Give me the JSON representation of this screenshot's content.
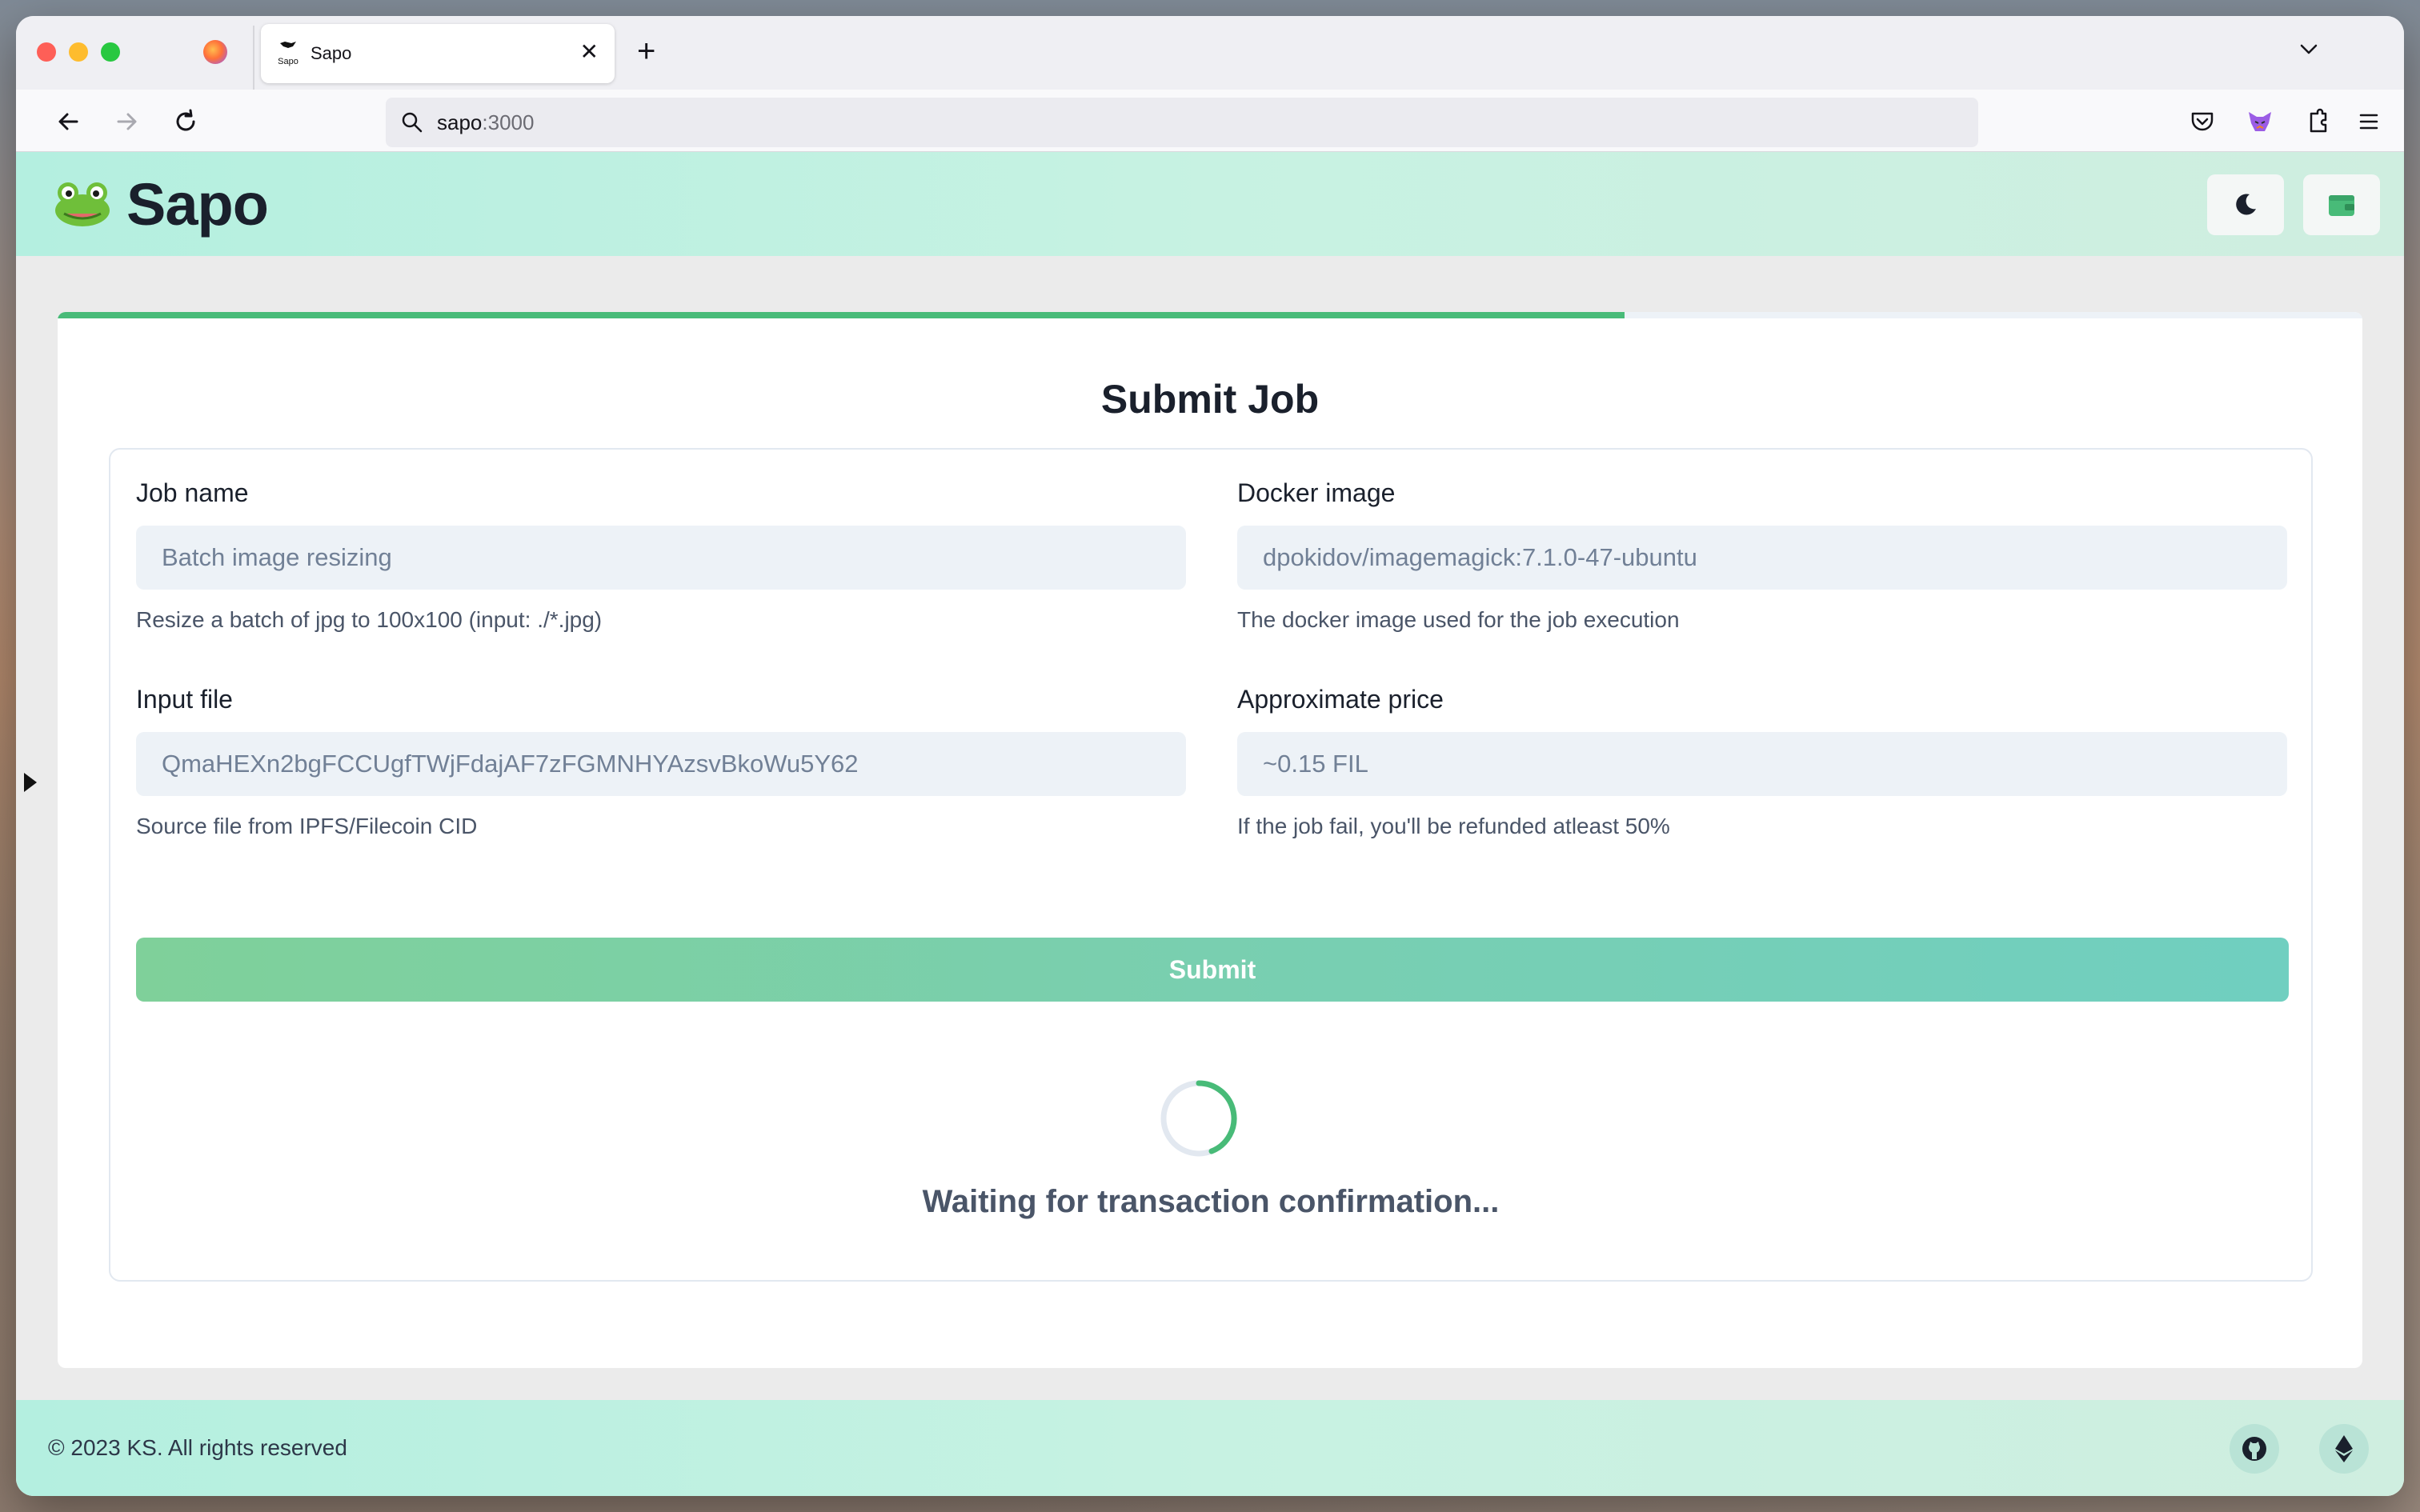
{
  "browser": {
    "tab_title": "Sapo",
    "tab_favicon_label": "Sapo",
    "url_host": "sapo",
    "url_port": ":3000"
  },
  "header": {
    "brand": "Sapo"
  },
  "form": {
    "title": "Submit Job",
    "progress_fraction": 0.68,
    "job_name": {
      "label": "Job name",
      "placeholder": "Batch image resizing",
      "help": "Resize a batch of jpg to 100x100 (input: ./*.jpg)"
    },
    "docker_image": {
      "label": "Docker image",
      "placeholder": "dpokidov/imagemagick:7.1.0-47-ubuntu",
      "help": "The docker image used for the job execution"
    },
    "input_file": {
      "label": "Input file",
      "placeholder": "QmaHEXn2bgFCCUgfTWjFdajAF7zFGMNHYAzsvBkoWu5Y62",
      "help": "Source file from IPFS/Filecoin CID"
    },
    "approx_price": {
      "label": "Approximate price",
      "placeholder": "~0.15 FIL",
      "help": "If the job fail, you'll be refunded atleast 50%"
    },
    "submit_label": "Submit",
    "status_text": "Waiting for transaction confirmation..."
  },
  "footer": {
    "copyright": "© 2023 KS. All rights reserved"
  },
  "colors": {
    "accent": "#48bb78",
    "header_gradient_start": "#b4efe0",
    "header_gradient_end": "#cfeee0"
  }
}
